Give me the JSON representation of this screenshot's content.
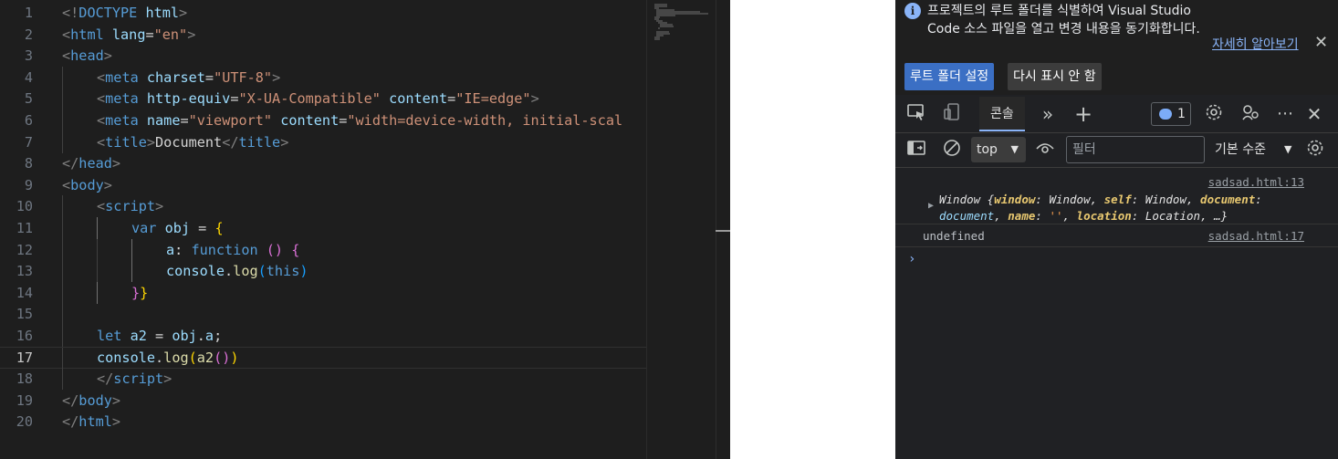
{
  "editor": {
    "active_line": 17,
    "lines": [
      {
        "n": "1",
        "indent": 0,
        "tokens": [
          [
            "br",
            "<!"
          ],
          [
            "tag",
            "DOCTYPE"
          ],
          [
            "txt",
            " "
          ],
          [
            "var",
            "html"
          ],
          [
            "br",
            ">"
          ]
        ]
      },
      {
        "n": "2",
        "indent": 0,
        "tokens": [
          [
            "br",
            "<"
          ],
          [
            "tag",
            "html"
          ],
          [
            "txt",
            " "
          ],
          [
            "attr",
            "lang"
          ],
          [
            "op",
            "="
          ],
          [
            "str",
            "\"en\""
          ],
          [
            "br",
            ">"
          ]
        ]
      },
      {
        "n": "3",
        "indent": 0,
        "tokens": [
          [
            "br",
            "<"
          ],
          [
            "tag",
            "head"
          ],
          [
            "br",
            ">"
          ]
        ]
      },
      {
        "n": "4",
        "indent": 1,
        "tokens": [
          [
            "br",
            "<"
          ],
          [
            "tag",
            "meta"
          ],
          [
            "txt",
            " "
          ],
          [
            "attr",
            "charset"
          ],
          [
            "op",
            "="
          ],
          [
            "str",
            "\"UTF-8\""
          ],
          [
            "br",
            ">"
          ]
        ]
      },
      {
        "n": "5",
        "indent": 1,
        "tokens": [
          [
            "br",
            "<"
          ],
          [
            "tag",
            "meta"
          ],
          [
            "txt",
            " "
          ],
          [
            "attr",
            "http-equiv"
          ],
          [
            "op",
            "="
          ],
          [
            "str",
            "\"X-UA-Compatible\""
          ],
          [
            "txt",
            " "
          ],
          [
            "attr",
            "content"
          ],
          [
            "op",
            "="
          ],
          [
            "str",
            "\"IE=edge\""
          ],
          [
            "br",
            ">"
          ]
        ]
      },
      {
        "n": "6",
        "indent": 1,
        "tokens": [
          [
            "br",
            "<"
          ],
          [
            "tag",
            "meta"
          ],
          [
            "txt",
            " "
          ],
          [
            "attr",
            "name"
          ],
          [
            "op",
            "="
          ],
          [
            "str",
            "\"viewport\""
          ],
          [
            "txt",
            " "
          ],
          [
            "attr",
            "content"
          ],
          [
            "op",
            "="
          ],
          [
            "str",
            "\"width=device-width, initial-scal"
          ]
        ]
      },
      {
        "n": "7",
        "indent": 1,
        "tokens": [
          [
            "br",
            "<"
          ],
          [
            "tag",
            "title"
          ],
          [
            "br",
            ">"
          ],
          [
            "txt",
            "Document"
          ],
          [
            "br",
            "</"
          ],
          [
            "tag",
            "title"
          ],
          [
            "br",
            ">"
          ]
        ]
      },
      {
        "n": "8",
        "indent": 0,
        "tokens": [
          [
            "br",
            "</"
          ],
          [
            "tag",
            "head"
          ],
          [
            "br",
            ">"
          ]
        ]
      },
      {
        "n": "9",
        "indent": 0,
        "tokens": [
          [
            "br",
            "<"
          ],
          [
            "tag",
            "body"
          ],
          [
            "br",
            ">"
          ]
        ]
      },
      {
        "n": "10",
        "indent": 1,
        "tokens": [
          [
            "br",
            "<"
          ],
          [
            "tag",
            "script"
          ],
          [
            "br",
            ">"
          ]
        ]
      },
      {
        "n": "11",
        "indent": 2,
        "tokens": [
          [
            "kw",
            "var"
          ],
          [
            "txt",
            " "
          ],
          [
            "var",
            "obj"
          ],
          [
            "op",
            " = "
          ],
          [
            "p1",
            "{"
          ]
        ]
      },
      {
        "n": "12",
        "indent": 3,
        "tokens": [
          [
            "var",
            "a"
          ],
          [
            "op",
            ": "
          ],
          [
            "kw",
            "function"
          ],
          [
            "txt",
            " "
          ],
          [
            "p2",
            "()"
          ],
          [
            "txt",
            " "
          ],
          [
            "p2",
            "{"
          ]
        ]
      },
      {
        "n": "13",
        "indent": 3,
        "tokens": [
          [
            "var",
            "console"
          ],
          [
            "op",
            "."
          ],
          [
            "fn",
            "log"
          ],
          [
            "p3",
            "("
          ],
          [
            "kw",
            "this"
          ],
          [
            "p3",
            ")"
          ]
        ]
      },
      {
        "n": "14",
        "indent": 2,
        "tokens": [
          [
            "p2",
            "}"
          ],
          [
            "p1",
            "}"
          ]
        ]
      },
      {
        "n": "15",
        "indent": 1,
        "tokens": []
      },
      {
        "n": "16",
        "indent": 1,
        "tokens": [
          [
            "kw",
            "let"
          ],
          [
            "txt",
            " "
          ],
          [
            "var",
            "a2"
          ],
          [
            "op",
            " = "
          ],
          [
            "var",
            "obj"
          ],
          [
            "op",
            "."
          ],
          [
            "var",
            "a"
          ],
          [
            "op",
            ";"
          ]
        ]
      },
      {
        "n": "17",
        "indent": 1,
        "tokens": [
          [
            "var",
            "console"
          ],
          [
            "op",
            "."
          ],
          [
            "fn",
            "log"
          ],
          [
            "p1",
            "("
          ],
          [
            "fn",
            "a2"
          ],
          [
            "p2",
            "()"
          ],
          [
            "p1",
            ")"
          ]
        ]
      },
      {
        "n": "18",
        "indent": 1,
        "tokens": [
          [
            "br",
            "</"
          ],
          [
            "tag",
            "script"
          ],
          [
            "br",
            ">"
          ]
        ]
      },
      {
        "n": "19",
        "indent": 0,
        "tokens": [
          [
            "br",
            "</"
          ],
          [
            "tag",
            "body"
          ],
          [
            "br",
            ">"
          ]
        ]
      },
      {
        "n": "20",
        "indent": 0,
        "tokens": [
          [
            "br",
            "</"
          ],
          [
            "tag",
            "html"
          ],
          [
            "br",
            ">"
          ]
        ]
      }
    ]
  },
  "devtools": {
    "infobar": {
      "message": "프로젝트의 루트 폴더를 식별하여 Visual Studio Code 소스 파일을 열고 변경 내용을 동기화합니다.",
      "learn_more": "자세히 알아보기",
      "set_root_button": "루트 폴더 설정",
      "dont_show_button": "다시 표시 안 함"
    },
    "tabs": {
      "console_label": "콘솔",
      "issues_count": "1"
    },
    "filter": {
      "context": "top",
      "placeholder": "필터",
      "level": "기본 수준"
    },
    "console": {
      "messages": [
        {
          "source": "sadsad.html:13"
        },
        {
          "text": "undefined",
          "source": "sadsad.html:17"
        }
      ],
      "window_object": {
        "name": "Window",
        "props": [
          {
            "key": "window",
            "value": "Window"
          },
          {
            "key": "self",
            "value": "Window"
          },
          {
            "key": "document",
            "value": "document"
          },
          {
            "key": "name",
            "value": "''"
          },
          {
            "key": "location",
            "value": "Location"
          }
        ],
        "ellipsis": "…"
      },
      "prompt": "›"
    }
  }
}
